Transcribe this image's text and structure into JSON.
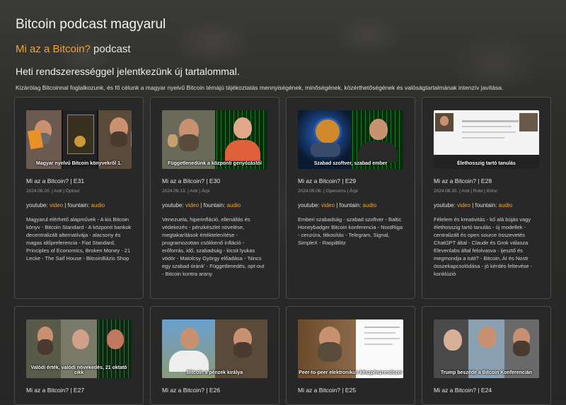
{
  "header": {
    "site_title": "Bitcoin podcast magyarul",
    "podcast_accent": "Mi az a Bitcoin?",
    "podcast_suffix": " podcast",
    "tagline": "Heti rendszerességgel jelentkezünk új tartalommal.",
    "description": "Kizárólag Bitcoinnal foglalkozunk, és fő célunk a magyar nyelvű Bitcoin témájú tájékoztatás mennyiségének, minőségének, közérthetőségének és valóságtartalmának intenzív javítása."
  },
  "links": {
    "youtube": "youtube:",
    "video": "video",
    "sep": "|",
    "fountain": "fountain:",
    "audio": "audio"
  },
  "episodes": [
    {
      "title": "Mi az a Bitcoin? | E31",
      "meta": "2024.09.20. | Anti | Optout",
      "thumb_caption": "Magyar nyelvű Bitcoin könyvekről 1.",
      "description": "Magyarul elérhető alapművek - A kis Bitcoin könyv - Bitcoin Standard - A központi bankok decentralizált alternatívája - alacsony és magas időpreferencia - Fiat Standard, Principles of Economics, Broken Money - 21 Lecke - The Saif House - BitcoinBázis Shop"
    },
    {
      "title": "Mi az a Bitcoin? | E30",
      "meta": "2024.09.13. | Anti | Árpi",
      "thumb_caption": "Függetlenedünk a központi genyózástól",
      "description": "Venezuela, hiperinfláció, ellenállás és védekezés - pénzkészlet növelése, megtakarítások értéktelenítése - programozottan csökkenő infláció - erőforrás, idő, szabadság - kicsit lyukas vödör - Matolcsy György előadása - 'Nincs egy szabad óránk' - Függetlenedés, opt-out - Bitcoin kontra arany"
    },
    {
      "title": "Mi az a Bitcoin? | E29",
      "meta": "2024.09.06. | Openoms | Árpi",
      "thumb_caption": "Szabad szoftver, szabad ember",
      "description": "Emberi szabadság - szabad szoftver - Baltic Honeybadger Bitcoin konferencia - NostRiga - cenzúra, titkosítás - Telegram, Signal, SimpleX - RaspiBlitz"
    },
    {
      "title": "Mi az a Bitcoin? | E28",
      "meta": "2024.08.30. | Anti | Robi | lörinc",
      "thumb_caption": "Élethosszig tartó tanulás",
      "description": "Félelem és kreativitás - kő alá bújás vagy élethosszig tartó tanulás - új modellek - centralizált és open source összevetés ChatGPT által - Claude és Grok válasza Elevenlabs által felolvasva - ijesztő és megmondja a tutit? - Bitcoin, AI és Nostr összekapcsolódása - jó kérdés feltevése - konklúzió"
    },
    {
      "title": "Mi az a Bitcoin? | E27",
      "thumb_caption": "Valódi érték, valódi növekedés, 21 oktató cikk"
    },
    {
      "title": "Mi az a Bitcoin? | E26",
      "thumb_caption": "Bitcoin a pénzek királya"
    },
    {
      "title": "Mi az a Bitcoin? | E25",
      "thumb_caption": "Peer-to-peer elektronikus készpénzrendszer"
    },
    {
      "title": "Mi az a Bitcoin? | E24",
      "thumb_caption": "Trump beszéde a Bitcoin Konferencián"
    }
  ],
  "colors": {
    "accent": "#f4a13a",
    "card_bg": "#282828",
    "text": "#e8e8e8"
  }
}
